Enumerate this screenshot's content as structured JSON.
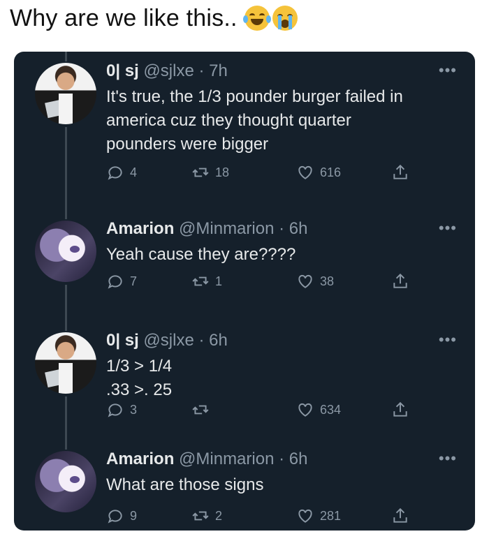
{
  "caption": "Why are we like this..",
  "caption_emojis": [
    "face-with-tears-of-joy",
    "loudly-crying-face"
  ],
  "tweets": [
    {
      "name": "0| sj",
      "handle": "@sjlxe",
      "time": "· 7h",
      "lines": [
        "It's true, the 1/3 pounder burger failed in",
        "america cuz they thought quarter",
        "pounders were bigger"
      ],
      "replies": "4",
      "retweets": "18",
      "likes": "616",
      "avatar": "man-in-tuxedo"
    },
    {
      "name": "Amarion",
      "handle": "@Minmarion",
      "time": "· 6h",
      "lines": [
        "Yeah cause they are????"
      ],
      "replies": "7",
      "retweets": "1",
      "likes": "38",
      "avatar": "anime-character"
    },
    {
      "name": "0| sj",
      "handle": "@sjlxe",
      "time": "· 6h",
      "lines": [
        "1/3 > 1/4",
        ".33 >. 25"
      ],
      "replies": "3",
      "retweets": "",
      "likes": "634",
      "avatar": "man-in-tuxedo"
    },
    {
      "name": "Amarion",
      "handle": "@Minmarion",
      "time": "· 6h",
      "lines": [
        "What are those signs"
      ],
      "replies": "9",
      "retweets": "2",
      "likes": "281",
      "avatar": "anime-character"
    }
  ],
  "more_glyph": "•••",
  "colors": {
    "background": "#15202b",
    "text": "#e7e9ea",
    "muted": "#8b98a5"
  }
}
